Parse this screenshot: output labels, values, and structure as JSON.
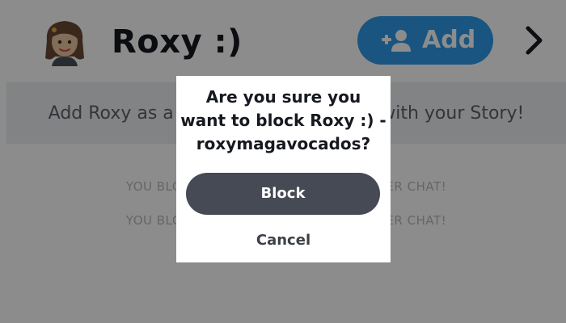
{
  "header": {
    "name": "Roxy :)",
    "add_label": "Add"
  },
  "banner": {
    "text": "Add Roxy as a friend to see and chat with your Story!"
  },
  "chat": {
    "lines": [
      "YOU BLOCKED ROXY, YOU CAN NO LONGER CHAT!",
      "YOU BLOCKED ROXY, YOU CAN NO LONGER CHAT!"
    ]
  },
  "dialog": {
    "line1": "Are you sure you",
    "line2": "want to block Roxy :) -",
    "line3": "roxymagavocados?",
    "block_label": "Block",
    "cancel_label": "Cancel"
  },
  "colors": {
    "accent": "#2f9bea",
    "block_button": "#454a54",
    "overlay": "rgba(0,0,0,0.45)"
  },
  "icons": {
    "avatar": "bitmoji-avatar",
    "add": "add-friend-icon",
    "chevron": "chevron-right-icon"
  }
}
